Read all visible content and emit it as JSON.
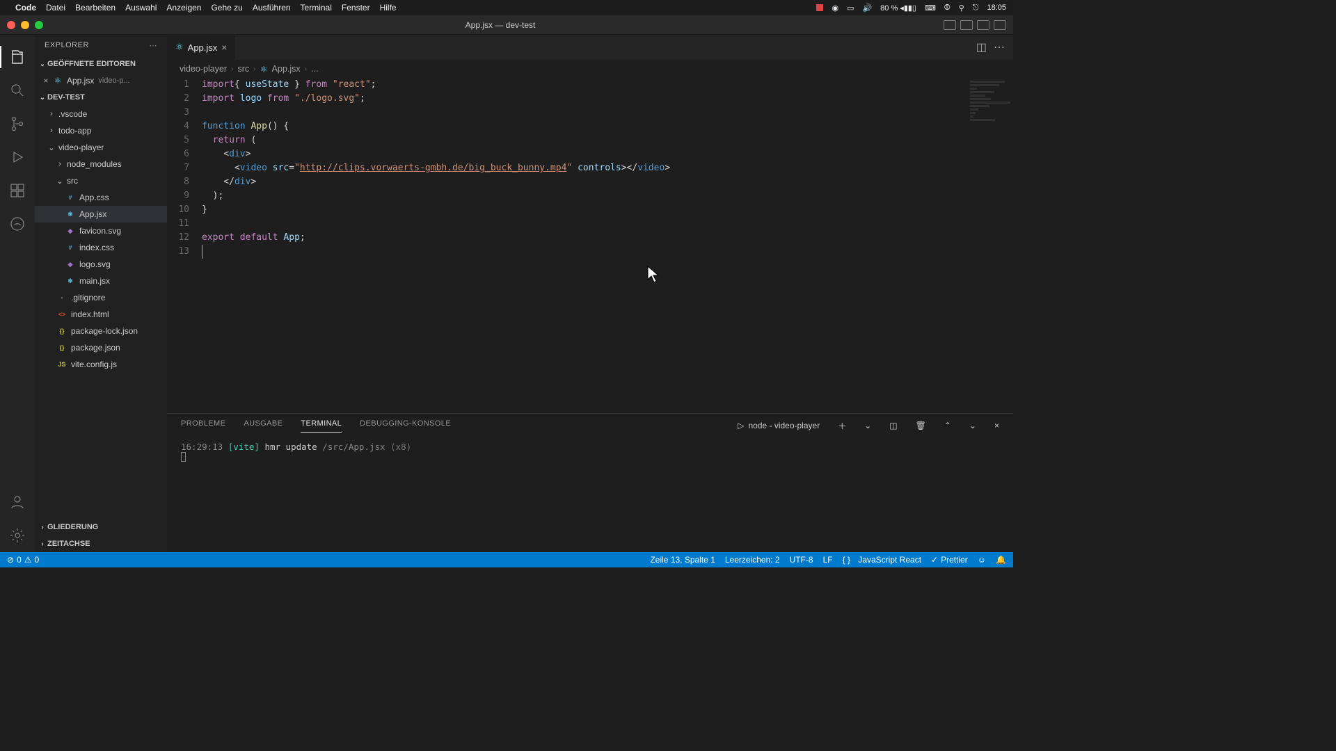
{
  "menubar": {
    "app": "Code",
    "items": [
      "Datei",
      "Bearbeiten",
      "Auswahl",
      "Anzeigen",
      "Gehe zu",
      "Ausführen",
      "Terminal",
      "Fenster",
      "Hilfe"
    ],
    "battery": "80 %",
    "clock": "18:05"
  },
  "titlebar": {
    "title": "App.jsx — dev-test"
  },
  "sidebar": {
    "title": "EXPLORER",
    "open_editors_label": "GEÖFFNETE EDITOREN",
    "open_editors": [
      {
        "name": "App.jsx",
        "path_suffix": "video-p..."
      }
    ],
    "workspace": "DEV-TEST",
    "tree": [
      {
        "type": "folder",
        "name": ".vscode",
        "depth": 0,
        "open": false
      },
      {
        "type": "folder",
        "name": "todo-app",
        "depth": 0,
        "open": false
      },
      {
        "type": "folder",
        "name": "video-player",
        "depth": 0,
        "open": true
      },
      {
        "type": "folder",
        "name": "node_modules",
        "depth": 1,
        "open": false
      },
      {
        "type": "folder",
        "name": "src",
        "depth": 1,
        "open": true
      },
      {
        "type": "file",
        "name": "App.css",
        "depth": 2,
        "badge": "css"
      },
      {
        "type": "file",
        "name": "App.jsx",
        "depth": 2,
        "badge": "react",
        "selected": true
      },
      {
        "type": "file",
        "name": "favicon.svg",
        "depth": 2,
        "badge": "svg"
      },
      {
        "type": "file",
        "name": "index.css",
        "depth": 2,
        "badge": "css"
      },
      {
        "type": "file",
        "name": "logo.svg",
        "depth": 2,
        "badge": "svg"
      },
      {
        "type": "file",
        "name": "main.jsx",
        "depth": 2,
        "badge": "react"
      },
      {
        "type": "file",
        "name": ".gitignore",
        "depth": 1,
        "badge": ""
      },
      {
        "type": "file",
        "name": "index.html",
        "depth": 1,
        "badge": "html"
      },
      {
        "type": "file",
        "name": "package-lock.json",
        "depth": 1,
        "badge": "json"
      },
      {
        "type": "file",
        "name": "package.json",
        "depth": 1,
        "badge": "json"
      },
      {
        "type": "file",
        "name": "vite.config.js",
        "depth": 1,
        "badge": "js"
      }
    ],
    "outline_label": "GLIEDERUNG",
    "timeline_label": "ZEITACHSE"
  },
  "tabs": {
    "active": {
      "label": "App.jsx"
    }
  },
  "breadcrumbs": [
    "video-player",
    "src",
    "App.jsx",
    "..."
  ],
  "editor": {
    "line_numbers": [
      "1",
      "2",
      "3",
      "4",
      "5",
      "6",
      "7",
      "8",
      "9",
      "10",
      "11",
      "12",
      "13"
    ],
    "code": {
      "l1": {
        "kw": "import",
        "br_o": "{ ",
        "id": "useState",
        "br_c": " }",
        "from": " from ",
        "str": "\"react\"",
        "semi": ";"
      },
      "l2": {
        "kw": "import",
        "id": " logo",
        "from": " from ",
        "str": "\"./logo.svg\"",
        "semi": ";"
      },
      "l4": {
        "kw": "function",
        "name": " App",
        "p": "() {",
        "open": ""
      },
      "l5": {
        "kw": "  return",
        "p": " ("
      },
      "l6": {
        "open": "    <",
        "tag": "div",
        "close": ">"
      },
      "l7": {
        "pre": "      <",
        "tag": "video",
        "sp": " ",
        "attr": "src",
        "eq": "=",
        "q": "\"",
        "url": "http://clips.vorwaerts-gmbh.de/big_buck_bunny.mp4",
        "q2": "\"",
        "sp2": " ",
        "attr2": "controls",
        "end": "></",
        "tag2": "video",
        "close": ">"
      },
      "l8": {
        "pre": "    </",
        "tag": "div",
        "close": ">"
      },
      "l9": {
        "p": "  );"
      },
      "l10": {
        "p": "}"
      },
      "l12": {
        "kw": "export",
        "kw2": " default",
        "id": " App",
        "semi": ";"
      }
    }
  },
  "panel": {
    "tabs": [
      "PROBLEME",
      "AUSGABE",
      "TERMINAL",
      "DEBUGGING-KONSOLE"
    ],
    "active_tab": 2,
    "term_label": "node - video-player",
    "output": {
      "ts": "16:29:13",
      "tag": "[vite]",
      "msg": "hmr update",
      "path": "/src/App.jsx",
      "count": "(x8)"
    }
  },
  "statusbar": {
    "errors": "0",
    "warnings": "0",
    "cursor": "Zeile 13, Spalte 1",
    "spaces": "Leerzeichen: 2",
    "encoding": "UTF-8",
    "eol": "LF",
    "language": "JavaScript React",
    "prettier": "Prettier"
  }
}
